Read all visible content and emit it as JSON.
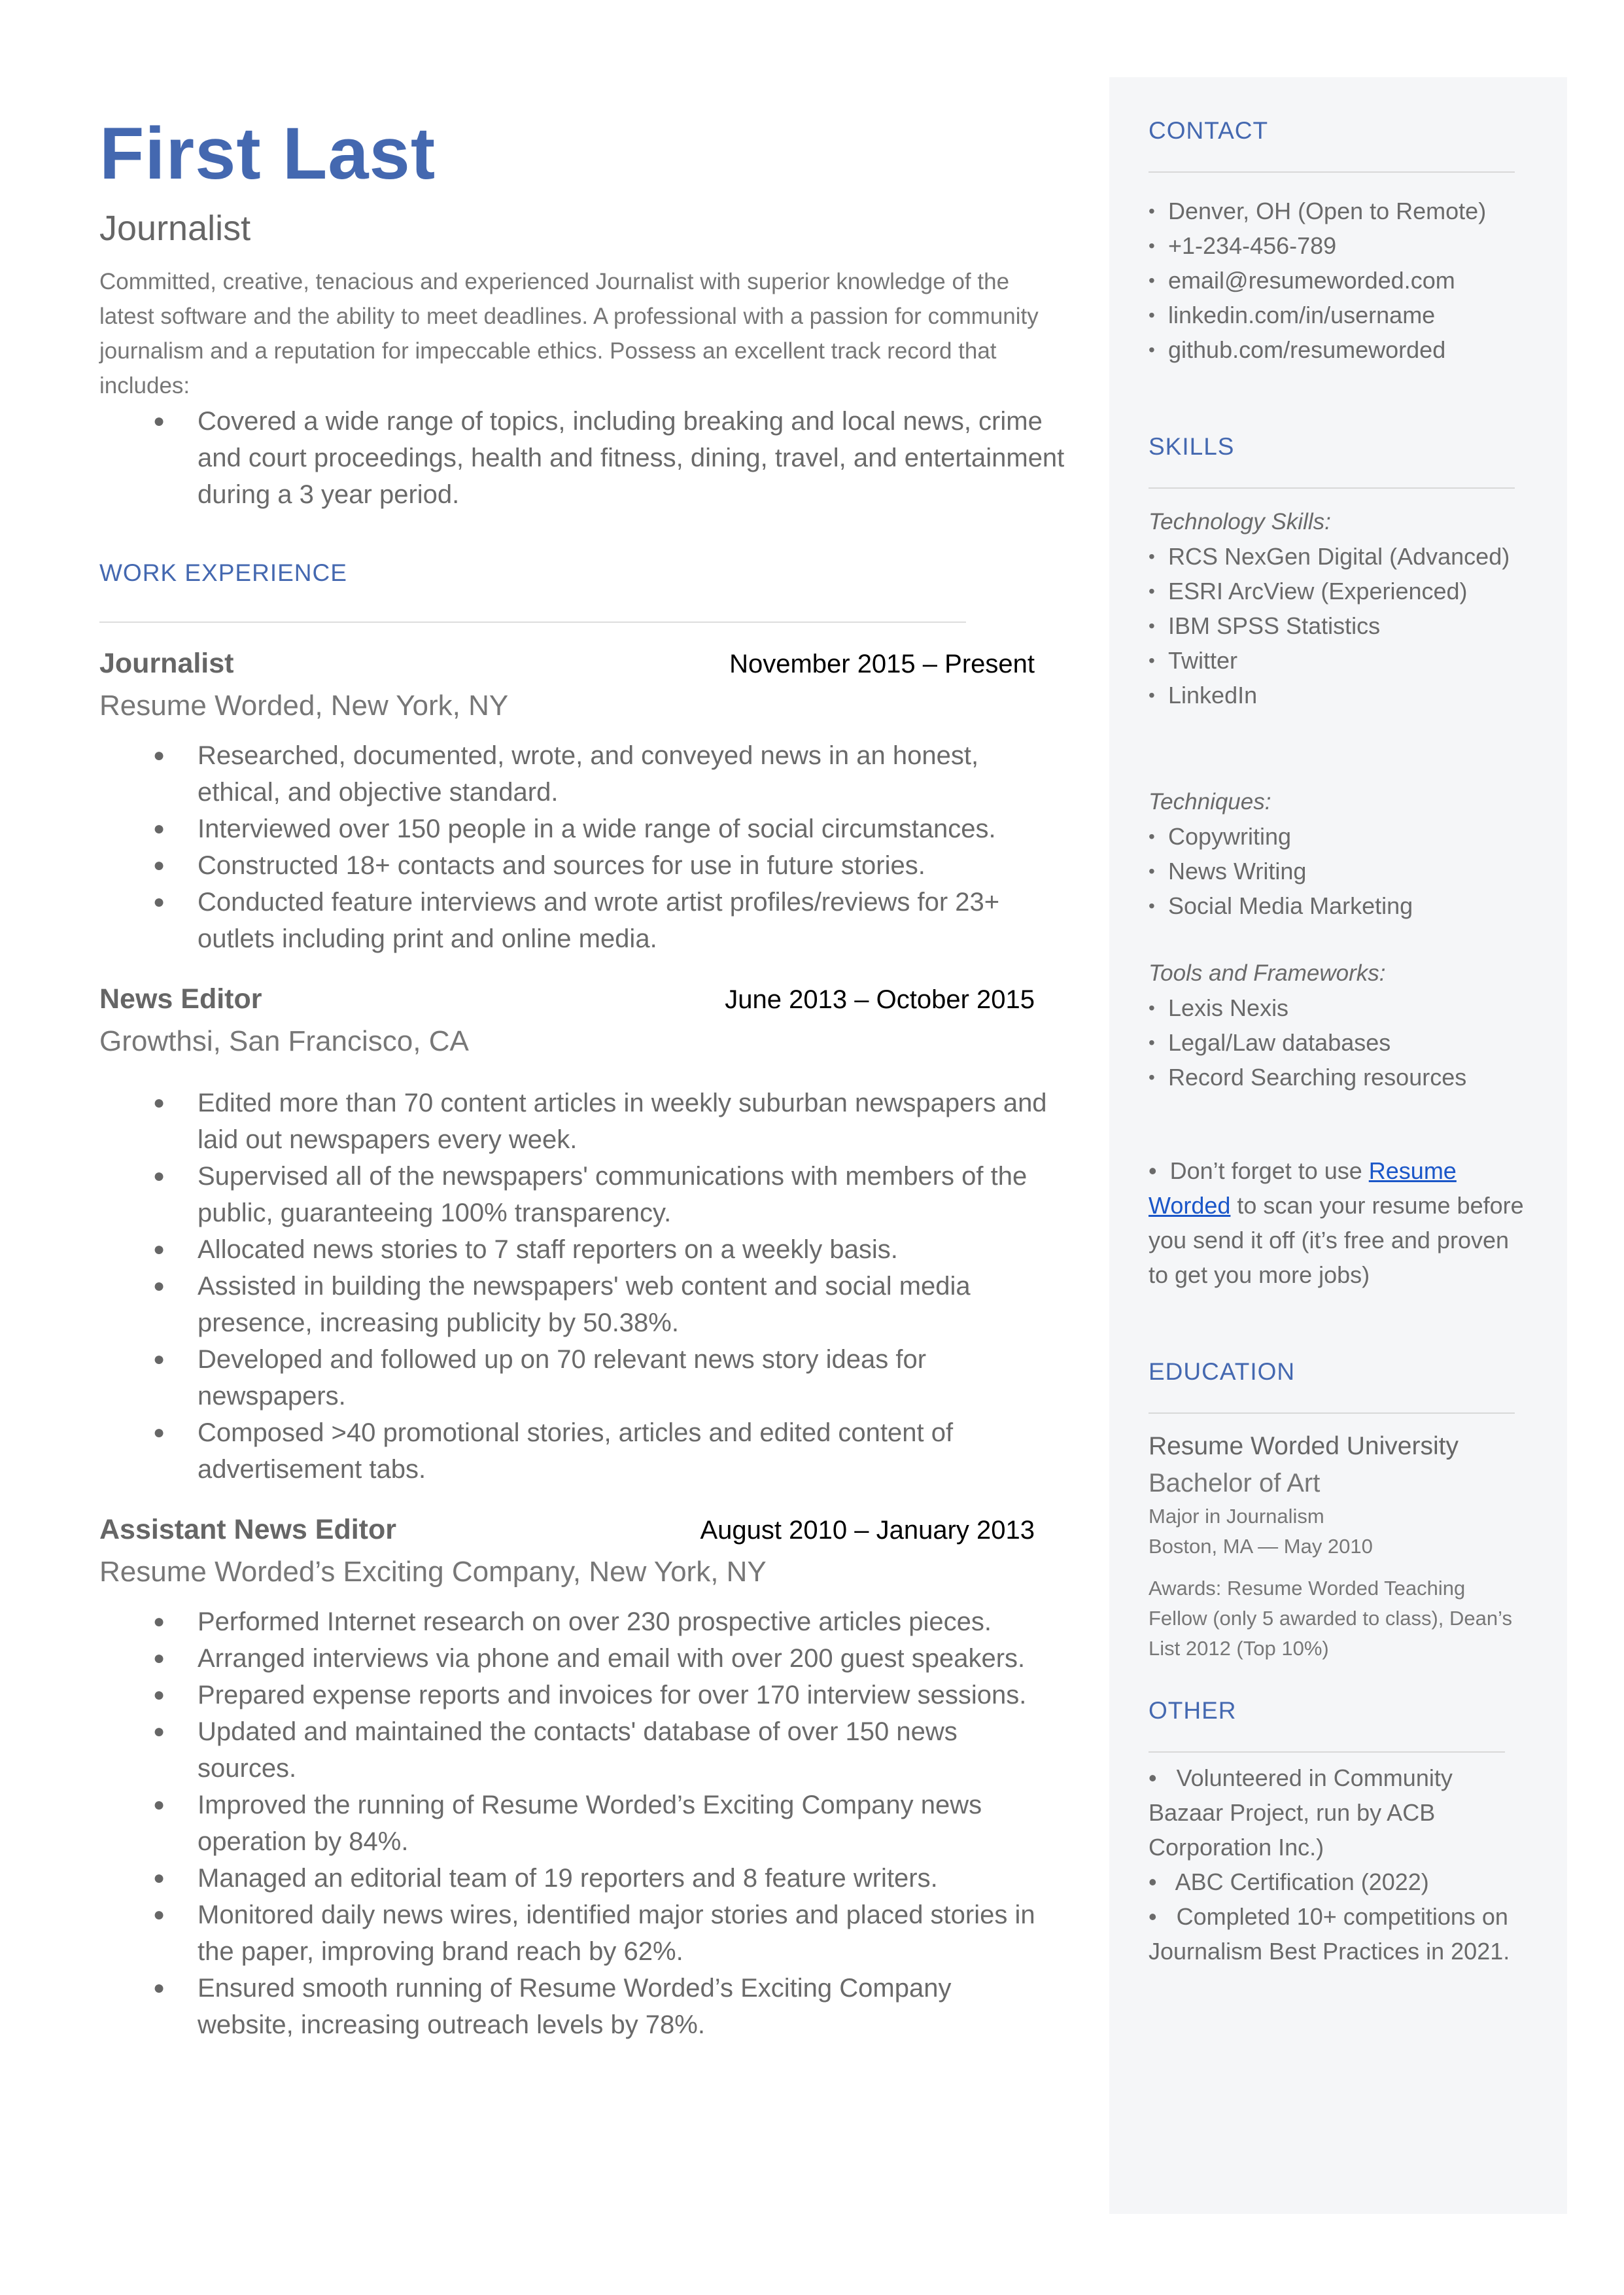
{
  "header": {
    "name": "First Last",
    "role": "Journalist",
    "summary": "Committed, creative, tenacious and experienced Journalist with superior knowledge of the latest software and the ability to meet deadlines. A professional with a passion for community journalism and a reputation for impeccable ethics. Possess an excellent track record that includes:",
    "summary_bullets": [
      "Covered a wide range of topics, including breaking and local news, crime and court proceedings, health and fitness, dining, travel, and entertainment during a 3 year period."
    ]
  },
  "work": {
    "title": "WORK EXPERIENCE",
    "jobs": [
      {
        "title": "Journalist",
        "dates": "November 2015 – Present",
        "company": "Resume Worded, New York, NY",
        "bullets": [
          "Researched, documented, wrote, and conveyed news in an honest, ethical, and objective standard.",
          "Interviewed over 150 people in a wide range of social circumstances.",
          "Constructed 18+ contacts and sources for use in future stories.",
          "Conducted feature interviews and wrote artist profiles/reviews for 23+ outlets including print and online media."
        ]
      },
      {
        "title": "News Editor",
        "dates": "June 2013 – October 2015",
        "company": "Growthsi, San Francisco, CA",
        "bullets": [
          "Edited more than 70 content articles in weekly suburban newspapers and laid out newspapers every week.",
          "Supervised all of the newspapers' communications with members of the public, guaranteeing 100% transparency.",
          "Allocated news stories to 7 staff reporters on a weekly basis.",
          "Assisted in building the newspapers' web content and social media presence, increasing publicity by 50.38%.",
          "Developed and followed up on 70 relevant news story ideas for newspapers.",
          "Composed >40 promotional stories, articles and edited content of advertisement tabs."
        ]
      },
      {
        "title": "Assistant News Editor",
        "dates": "August 2010 – January 2013",
        "company": "Resume Worded’s Exciting Company, New York, NY",
        "bullets": [
          "Performed Internet research on over 230 prospective articles pieces.",
          "Arranged interviews via phone and email with over 200 guest speakers.",
          "Prepared expense reports and invoices for over 170 interview sessions.",
          "Updated and maintained the contacts' database of over 150 news sources.",
          "Improved the running of Resume Worded’s Exciting Company news operation by 84%.",
          "Managed an editorial team of 19 reporters and 8 feature writers.",
          "Monitored daily news wires, identified major stories and placed stories in the paper, improving brand reach by 62%.",
          "Ensured smooth running of Resume Worded’s Exciting Company website, increasing outreach levels by 78%."
        ]
      }
    ]
  },
  "sidebar": {
    "contact": {
      "title": "CONTACT",
      "items": [
        "Denver, OH (Open to Remote)",
        "+1-234-456-789",
        "email@resumeworded.com",
        "linkedin.com/in/username",
        "github.com/resumeworded"
      ]
    },
    "skills": {
      "title": "SKILLS",
      "groups": [
        {
          "label": "Technology Skills:",
          "items": [
            "RCS NexGen Digital (Advanced)",
            "ESRI ArcView (Experienced)",
            "IBM SPSS Statistics",
            "Twitter",
            "LinkedIn"
          ]
        },
        {
          "label": "Techniques:",
          "items": [
            "Copywriting",
            "News Writing",
            "Social Media Marketing"
          ]
        },
        {
          "label": "Tools and Frameworks:",
          "items": [
            "Lexis Nexis",
            "Legal/Law databases",
            "Record Searching resources"
          ]
        }
      ],
      "tip_prefix": "Don’t forget to use ",
      "tip_link": "Resume Worded",
      "tip_suffix": " to scan your resume before you send it off (it’s free and proven to get you more jobs)"
    },
    "education": {
      "title": "EDUCATION",
      "school": "Resume Worded University",
      "degree": "Bachelor of Art",
      "major": "Major in Journalism",
      "location_date": "Boston, MA — May 2010",
      "awards": "Awards: Resume Worded Teaching Fellow (only 5 awarded to class), Dean’s List 2012 (Top 10%)"
    },
    "other": {
      "title": "OTHER",
      "items": [
        "Volunteered in Community Bazaar Project, run by ACB Corporation Inc.)",
        "ABC Certification (2022)",
        "Completed 10+ competitions on Journalism Best Practices  in 2021."
      ]
    }
  },
  "colors": {
    "accent": "#4468b0",
    "link": "#1a56c8",
    "sidebar_bg": "#f5f6f8",
    "text": "#666666"
  }
}
